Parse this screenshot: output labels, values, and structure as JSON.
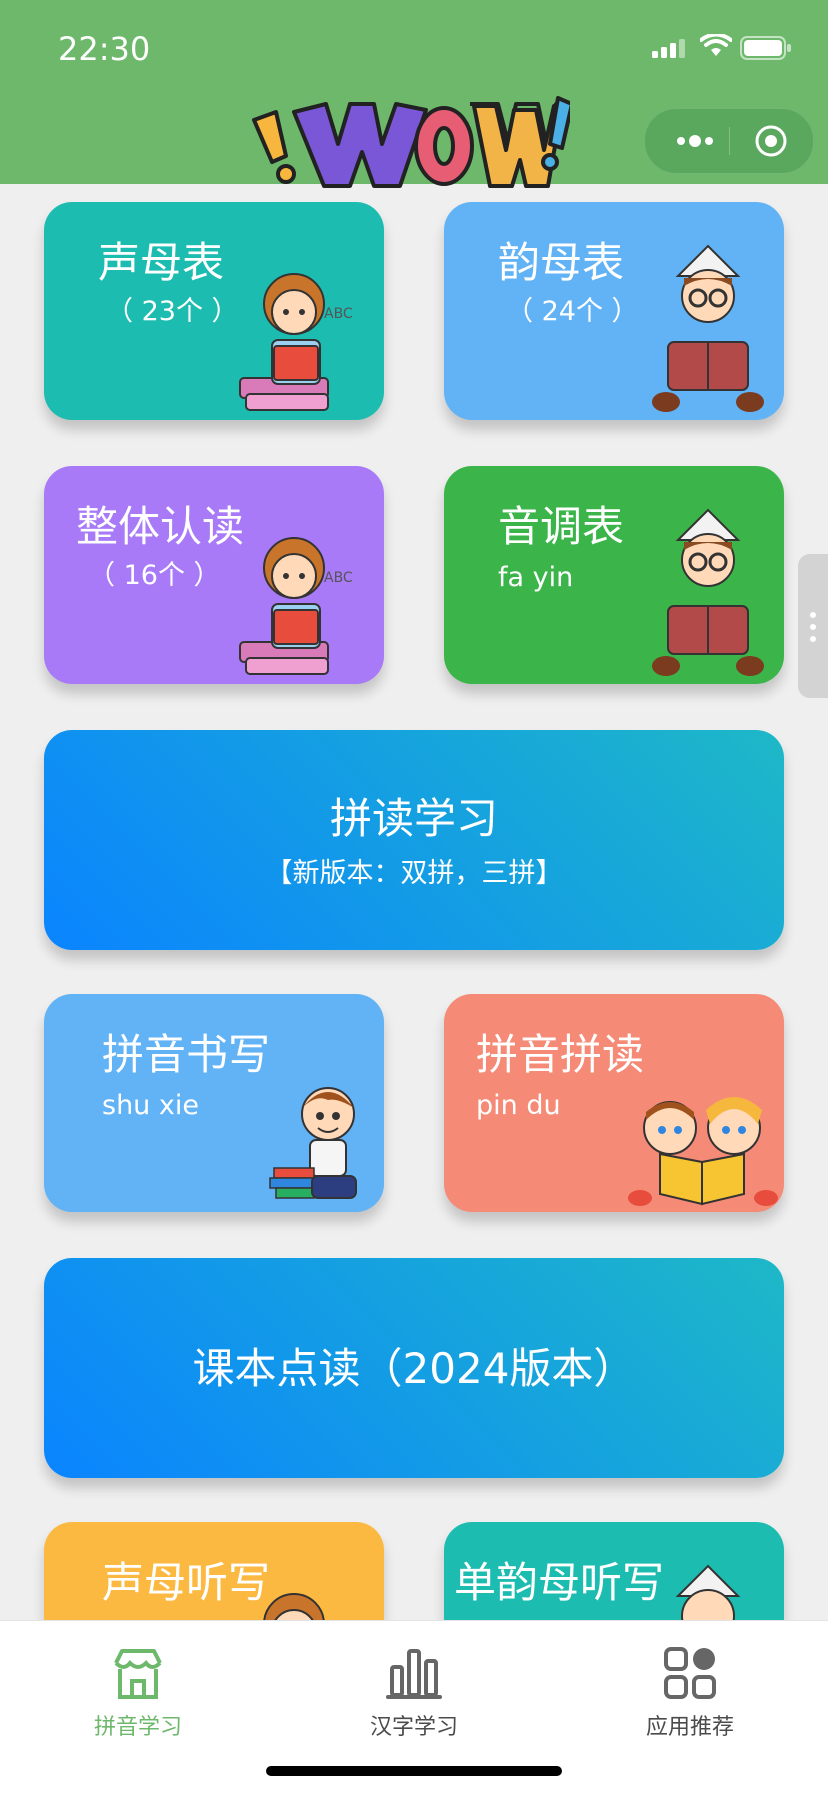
{
  "status_bar": {
    "time": "22:30"
  },
  "header": {
    "logo_text": "WOW!"
  },
  "cards": [
    {
      "title": "声母表",
      "sub": "（ 23个 ）"
    },
    {
      "title": "韵母表",
      "sub": "（ 24个 ）"
    },
    {
      "title": "整体认读",
      "sub": "（ 16个 ）"
    },
    {
      "title": "音调表",
      "sub": "fa yin"
    },
    {
      "title": "拼读学习",
      "sub": "【新版本：双拼，三拼】"
    },
    {
      "title": "拼音书写",
      "sub": "shu xie"
    },
    {
      "title": "拼音拼读",
      "sub": "pin du"
    },
    {
      "title": "课本点读（2024版本）"
    },
    {
      "title": "声母听写"
    },
    {
      "title": "单韵母听写"
    }
  ],
  "tabs": [
    {
      "label": "拼音学习",
      "icon": "house-icon",
      "active": true
    },
    {
      "label": "汉字学习",
      "icon": "bar-chart-icon",
      "active": false
    },
    {
      "label": "应用推荐",
      "icon": "grid-icon",
      "active": false
    }
  ],
  "colors": {
    "header_green": "#6db86b",
    "teal": "#1dbcb0",
    "sky": "#62b3f6",
    "purple": "#a87af8",
    "green": "#3bb54a",
    "salmon": "#f58a76",
    "orange": "#fbb942",
    "gradient_start": "#0a84ff",
    "gradient_end": "#1eb8c7"
  }
}
